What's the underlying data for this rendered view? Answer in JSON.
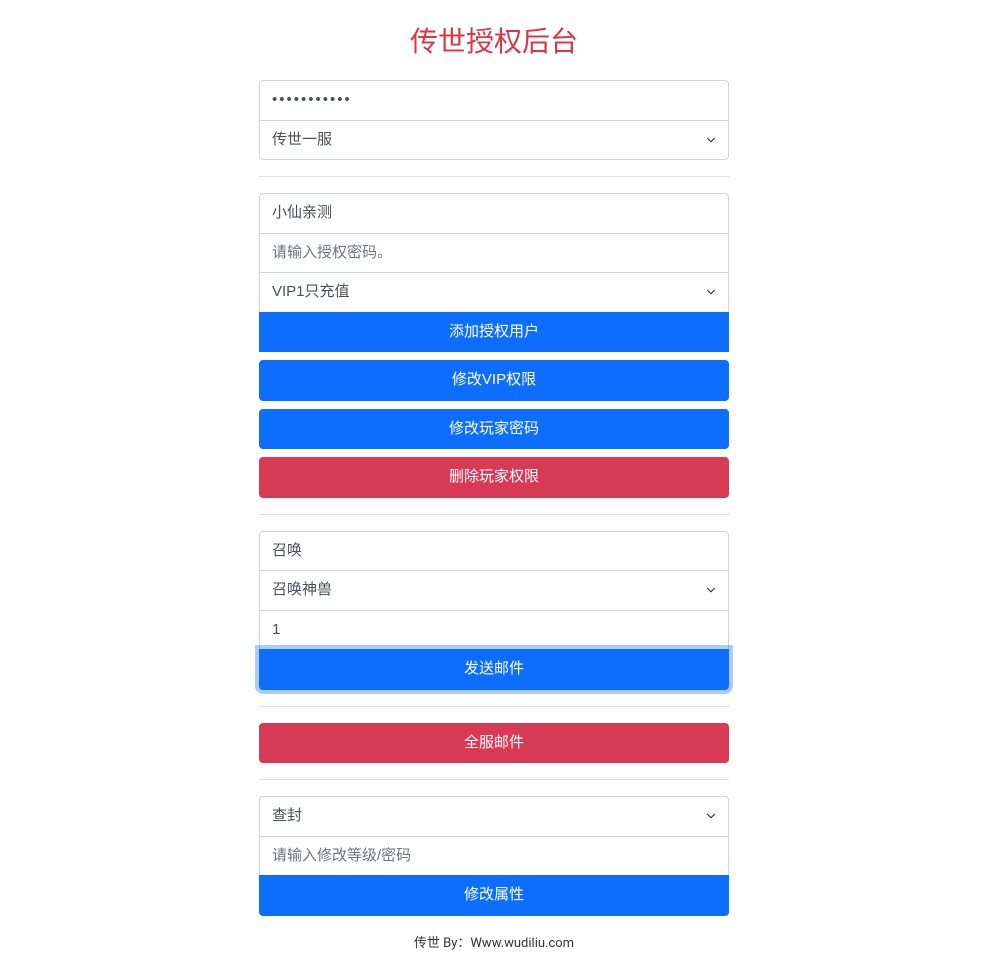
{
  "title": "传世授权后台",
  "section1": {
    "password_value": "•••••••••••",
    "server_select": "传世一服"
  },
  "section2": {
    "username_value": "小仙亲测",
    "auth_password_placeholder": "请输入授权密码。",
    "vip_select": "VIP1只充值",
    "btn_add_user": "添加授权用户",
    "btn_modify_vip": "修改VIP权限",
    "btn_modify_password": "修改玩家密码",
    "btn_delete_permission": "删除玩家权限"
  },
  "section3": {
    "summon_value": "召唤",
    "summon_select": "召唤神兽",
    "quantity_value": "1",
    "btn_send_mail": "发送邮件"
  },
  "section4": {
    "btn_global_mail": "全服邮件"
  },
  "section5": {
    "action_select": "查封",
    "level_password_placeholder": "请输入修改等级/密码",
    "btn_modify_attribute": "修改属性"
  },
  "footer": "传世 By：Www.wudiliu.com"
}
